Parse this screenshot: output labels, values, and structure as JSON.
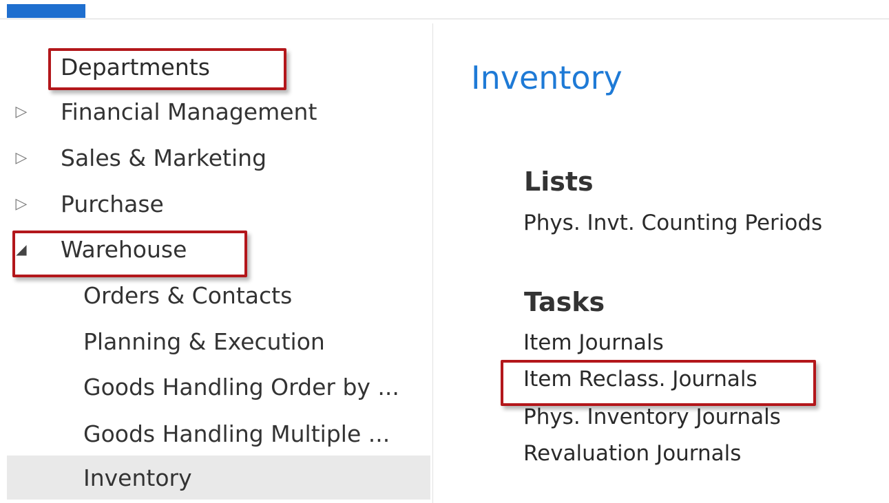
{
  "nav": {
    "header": "Departments",
    "items": [
      {
        "label": "Financial Management",
        "expander": "▷"
      },
      {
        "label": "Sales & Marketing",
        "expander": "▷"
      },
      {
        "label": "Purchase",
        "expander": "▷"
      },
      {
        "label": "Warehouse",
        "expander": "◢"
      }
    ],
    "sub_items": [
      {
        "label": "Orders & Contacts"
      },
      {
        "label": "Planning & Execution"
      },
      {
        "label": "Goods Handling Order by ..."
      },
      {
        "label": "Goods Handling Multiple ..."
      },
      {
        "label": "Inventory"
      }
    ]
  },
  "content": {
    "title": "Inventory",
    "lists_heading": "Lists",
    "lists": [
      "Phys. Invt. Counting Periods"
    ],
    "tasks_heading": "Tasks",
    "tasks": [
      "Item Journals",
      "Item Reclass. Journals",
      "Phys. Inventory Journals",
      "Revaluation Journals"
    ]
  },
  "colors": {
    "accent": "#1f6fcf",
    "title": "#1e7ad6",
    "highlight_box": "#b3171b",
    "selected_row": "#e9e9e9"
  }
}
